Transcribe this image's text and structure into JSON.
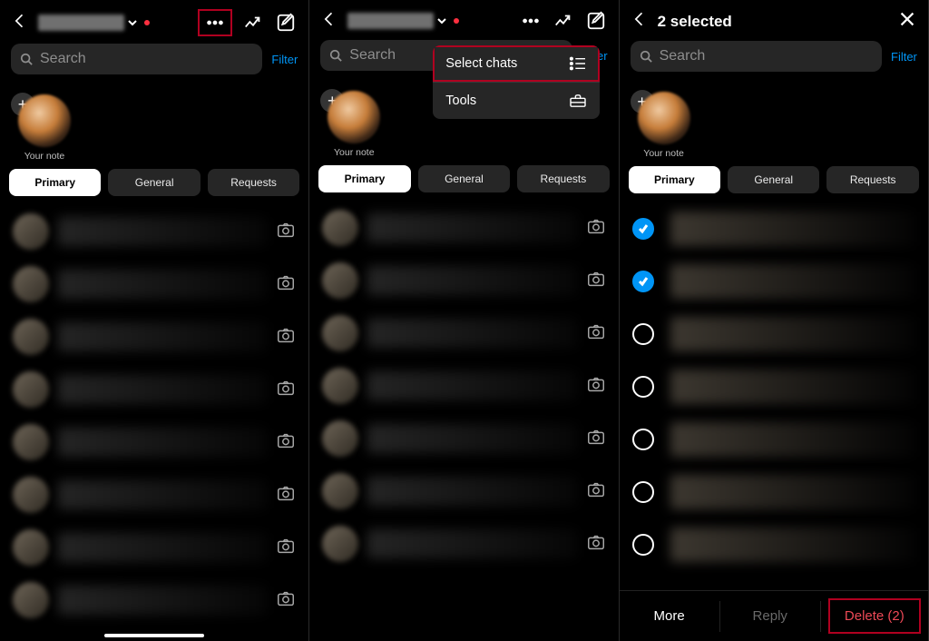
{
  "common": {
    "search_placeholder": "Search",
    "filter_label": "Filter",
    "note_label": "Your note",
    "tabs": {
      "primary": "Primary",
      "general": "General",
      "requests": "Requests"
    }
  },
  "screen1": {
    "chat_count": 8
  },
  "screen2": {
    "menu": {
      "select_chats": "Select chats",
      "tools": "Tools"
    },
    "chat_count": 7
  },
  "screen3": {
    "title": "2 selected",
    "rows": [
      {
        "selected": true
      },
      {
        "selected": true
      },
      {
        "selected": false
      },
      {
        "selected": false
      },
      {
        "selected": false
      },
      {
        "selected": false
      },
      {
        "selected": false
      }
    ],
    "bottom": {
      "more": "More",
      "reply": "Reply",
      "delete": "Delete (2)"
    }
  }
}
